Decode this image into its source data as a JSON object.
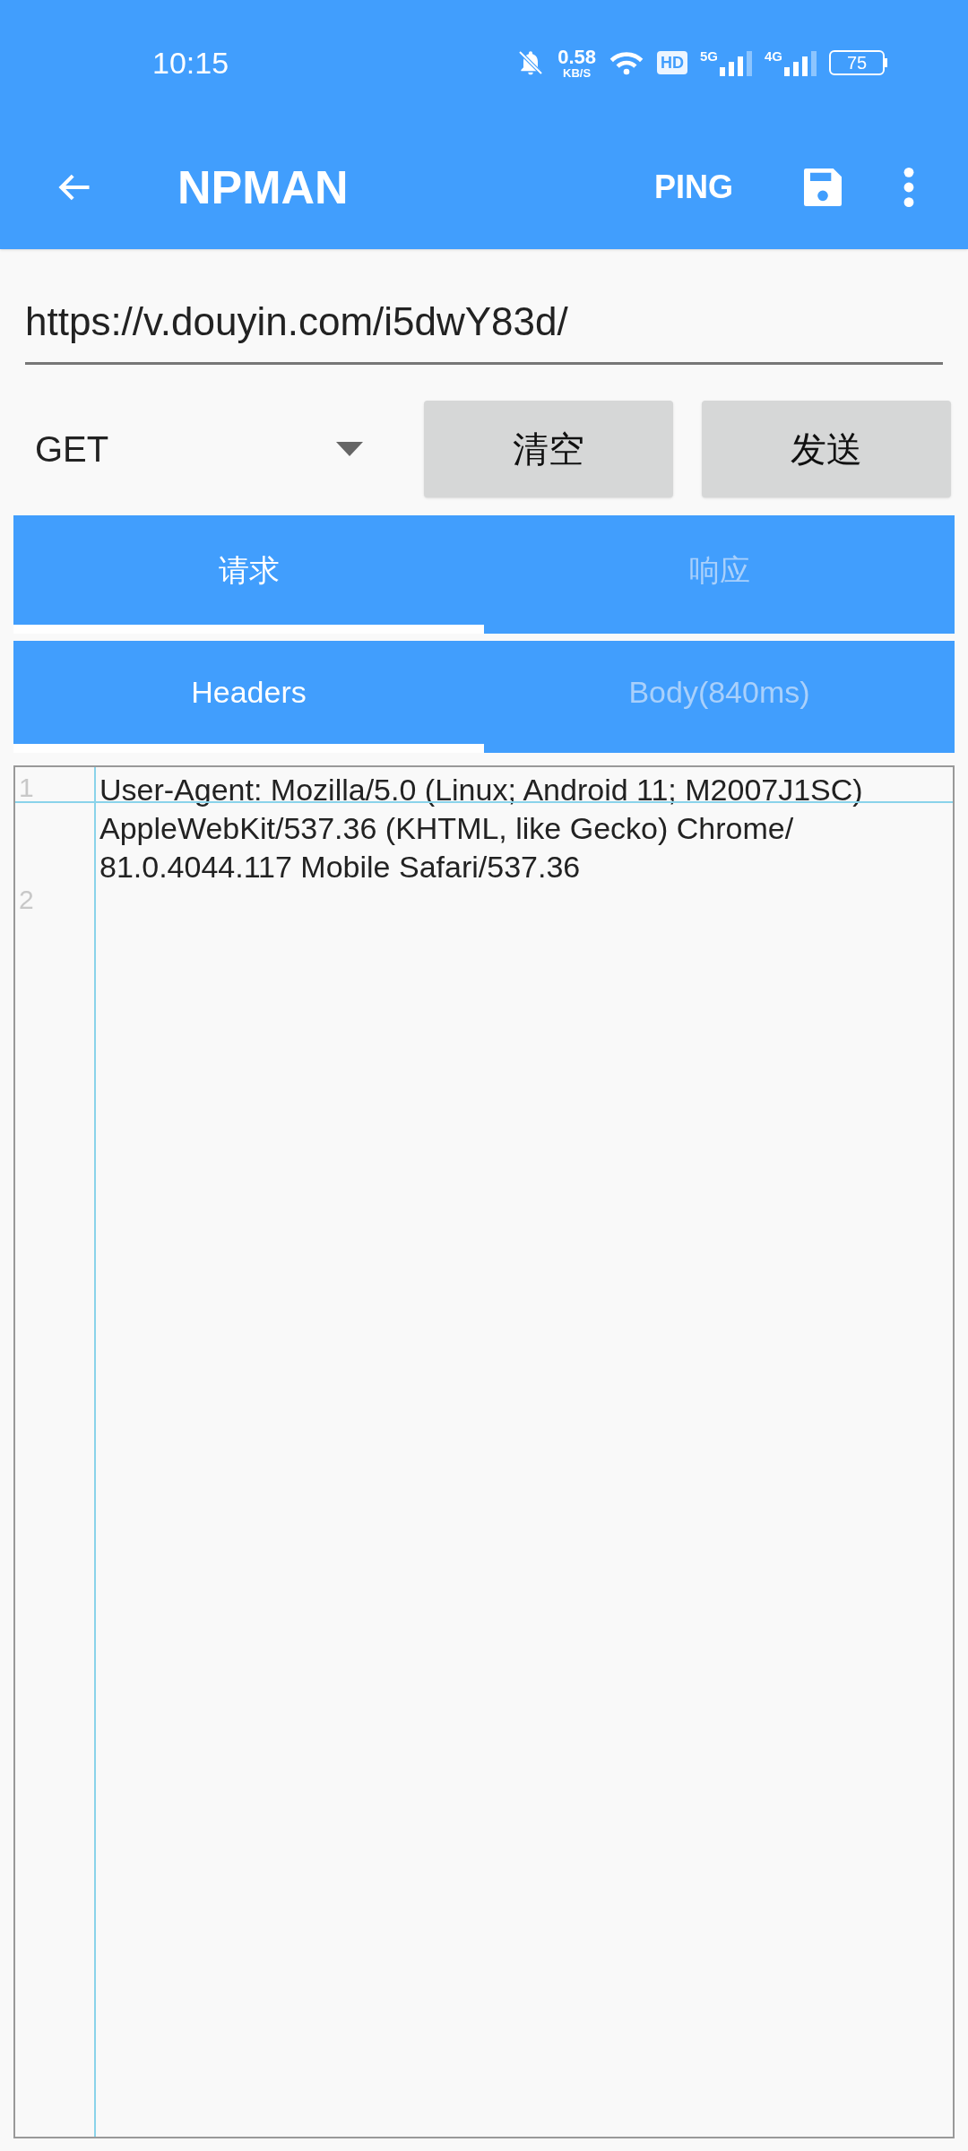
{
  "status_bar": {
    "time": "10:15",
    "net_speed": "0.58",
    "net_unit": "KB/S",
    "hd": "HD",
    "signals": [
      {
        "label": "5G",
        "level": 0.75
      },
      {
        "label": "4G",
        "level": 0.75
      }
    ],
    "battery": "75"
  },
  "app_bar": {
    "title": "NPMAN",
    "action": "PING"
  },
  "url_field": {
    "value": "https://v.douyin.com/i5dwY83d/"
  },
  "method": {
    "value": "GET"
  },
  "buttons": [
    "清空",
    "发送"
  ],
  "tabs": [
    {
      "label": "请求",
      "selected": true
    },
    {
      "label": "响应",
      "selected": false
    }
  ],
  "sub_tabs": [
    {
      "label": "Headers",
      "selected": true
    },
    {
      "label": "Body(840ms)",
      "selected": false
    }
  ],
  "editor": {
    "lines": [
      {
        "number": "1",
        "text": "User-Agent: Mozilla/5.0 (Linux; Android 11; M2007J1SC) AppleWebKit/537.36 (KHTML, like Gecko) Chrome/ 81.0.4044.117 Mobile Safari/537.36"
      },
      {
        "number": "2"
      }
    ]
  }
}
